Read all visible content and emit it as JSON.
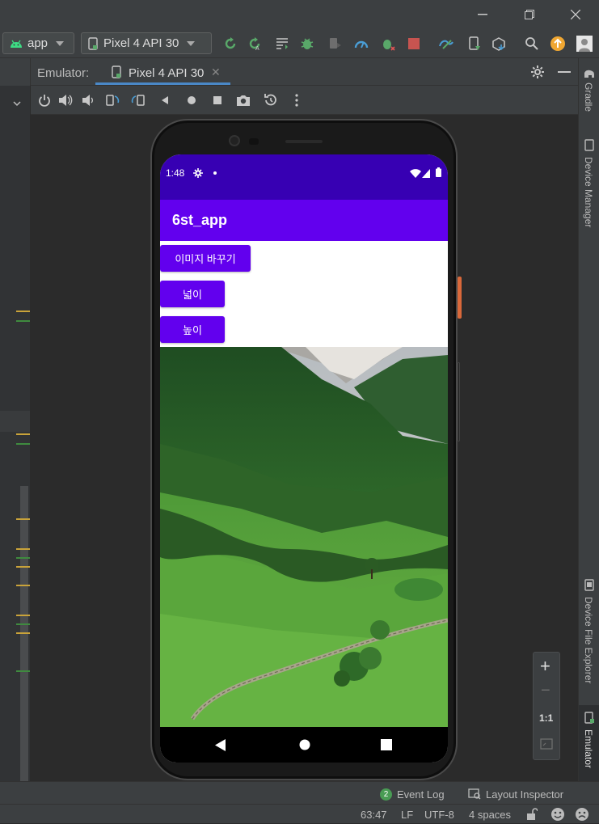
{
  "ide": {
    "run_config": "app",
    "device": "Pixel 4 API 30",
    "emulator_label": "Emulator:",
    "emulator_tab": "Pixel 4 API 30"
  },
  "right_sidebar": [
    "Gradle",
    "Device Manager",
    "Device File Explorer",
    "Emulator"
  ],
  "phone": {
    "status_time": "1:48",
    "app_title": "6st_app",
    "buttons": [
      "이미지 바꾸기",
      "넓이",
      "높이"
    ]
  },
  "zoom_controls": {
    "plus": "+",
    "minus": "−",
    "one_to_one": "1:1"
  },
  "bottom_tabs": {
    "event_log_badge": "2",
    "event_log": "Event Log",
    "layout_inspector": "Layout Inspector"
  },
  "status_line": {
    "position": "63:47",
    "line_ending": "LF",
    "encoding": "UTF-8",
    "indent": "4 spaces"
  },
  "colors": {
    "primary": "#6200ee",
    "primary_dark": "#3700b3",
    "ide_bg": "#2b2b2b",
    "ide_panel": "#3c3f41",
    "accent_tab": "#4a88c7"
  }
}
